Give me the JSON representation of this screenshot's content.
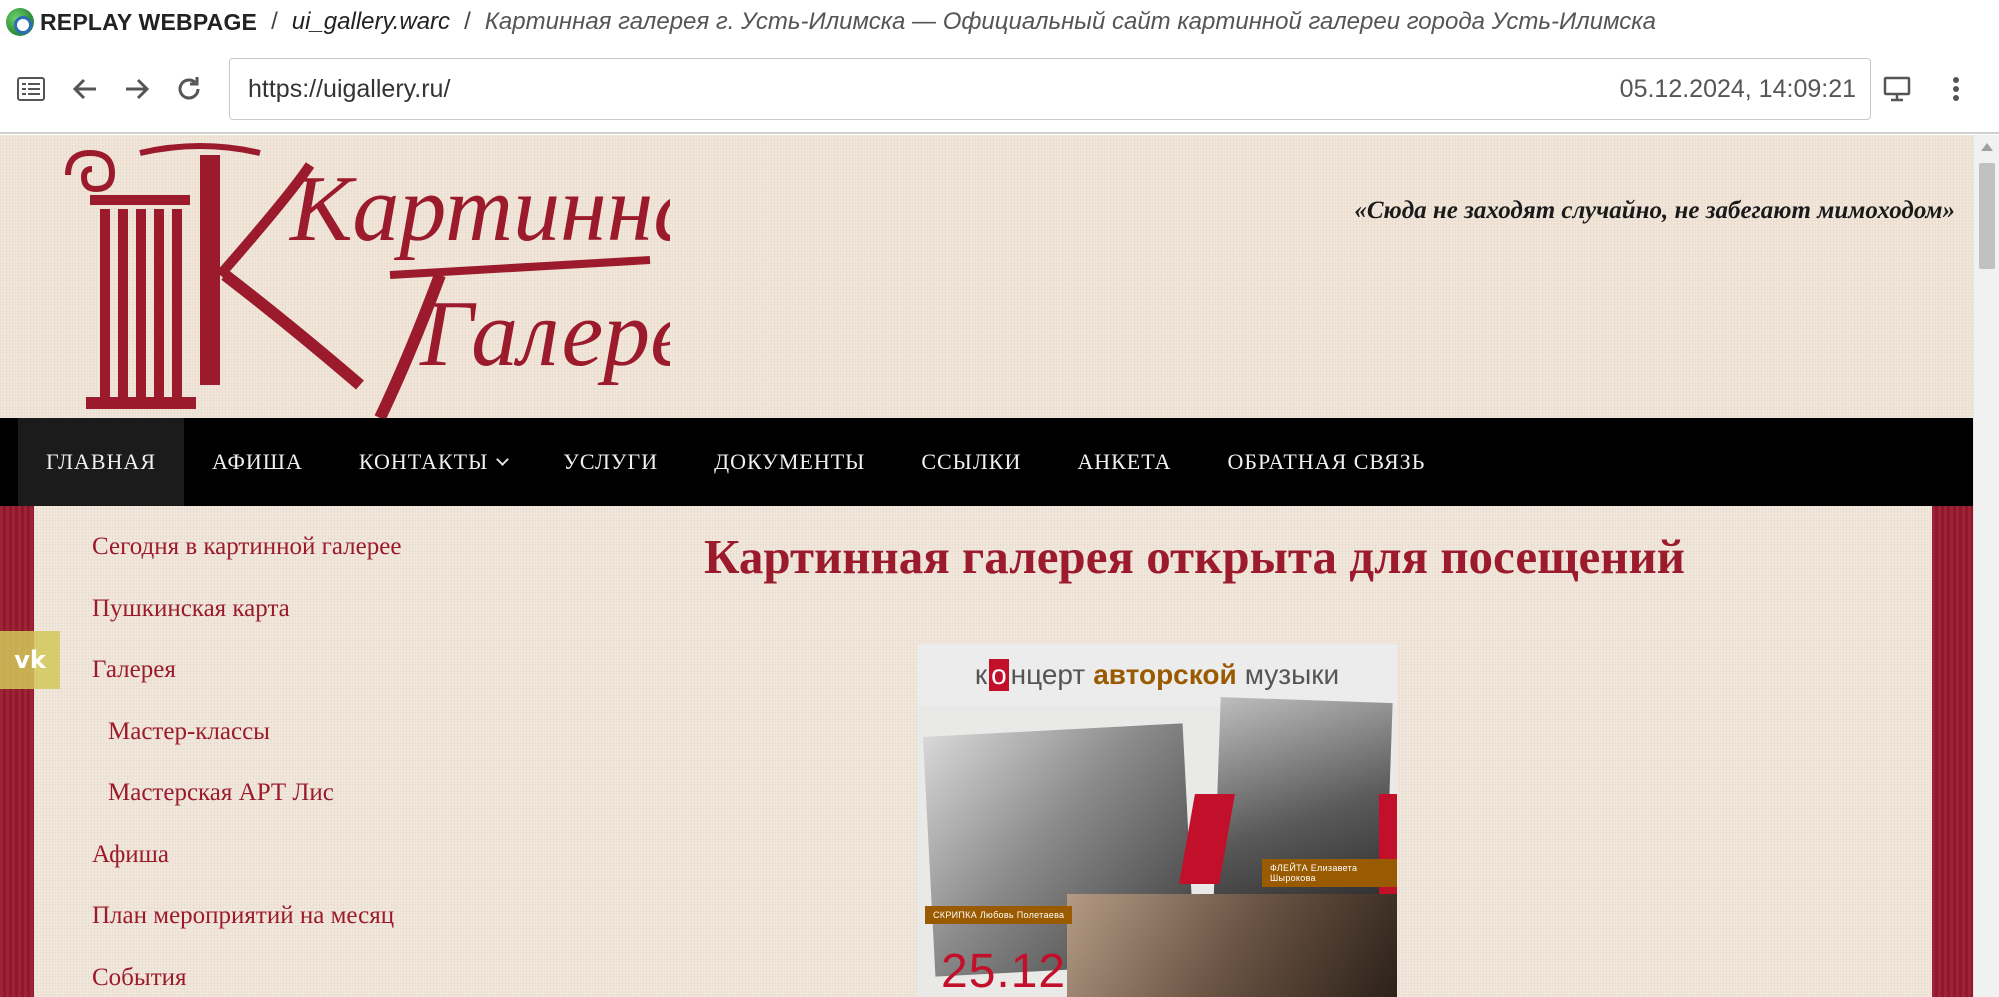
{
  "replay": {
    "brand": "REPLAY WEBPAGE",
    "separator": "/",
    "archive": "ui_gallery.warc",
    "page_title": "Картинная галерея г. Усть-Илимска — Официальный сайт картинной галереи города Усть-Илимска"
  },
  "toolbar": {
    "url": "https://uigallery.ru/",
    "timestamp": "05.12.2024, 14:09:21",
    "icons": [
      "sidebar-icon",
      "back-arrow-icon",
      "forward-arrow-icon",
      "reload-icon",
      "desktop-icon",
      "kebab-menu-icon"
    ]
  },
  "site": {
    "logo_line1": "Картинная",
    "logo_line2": "Галерея",
    "motto": "«Сюда не заходят случайно, не забегают мимоходом»"
  },
  "nav": {
    "items": [
      {
        "label": "Главная"
      },
      {
        "label": "Афиша"
      },
      {
        "label": "Контакты"
      },
      {
        "label": "Услуги"
      },
      {
        "label": "Документы"
      },
      {
        "label": "Ссылки"
      },
      {
        "label": "Анкета"
      },
      {
        "label": "Обратная связь"
      }
    ]
  },
  "social": {
    "vk_label": "vk"
  },
  "sidebar": {
    "items": [
      {
        "label": "Сегодня в картинной галерее"
      },
      {
        "label": "Пушкинская карта"
      },
      {
        "label": "Галерея"
      },
      {
        "label": "Мастер-классы"
      },
      {
        "label": "Мастерская АРТ Лис"
      },
      {
        "label": "Афиша"
      },
      {
        "label": "План мероприятий на месяц"
      },
      {
        "label": "События"
      }
    ]
  },
  "main": {
    "title": "Картинная галерея открыта для посещений",
    "poster": {
      "head_pre": "к",
      "head_mark": "о",
      "head_mid": "нцерт",
      "head_bold": "авторской",
      "head_post": "музыки",
      "tag_violin": "СКРИПКА Любовь Полетаева",
      "tag_flute": "ФЛЕЙТА Елизавета Шырокова",
      "date": "25.12"
    }
  },
  "colors": {
    "brand_red": "#9b1b2c",
    "nav_bg": "#000000",
    "page_bg": "#efe3d6",
    "poster_accent": "#c3102a",
    "poster_gold": "#9a5a00"
  }
}
